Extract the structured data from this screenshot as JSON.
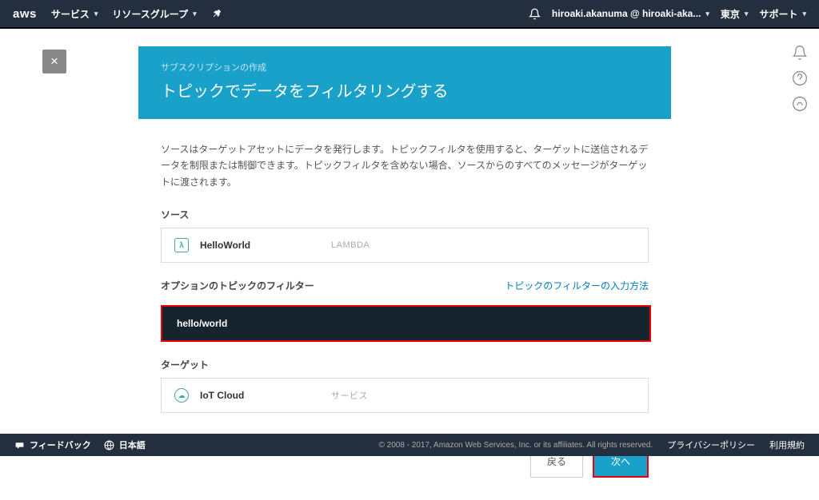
{
  "nav": {
    "logo": "aws",
    "services": "サービス",
    "resource_groups": "リソースグループ",
    "pin": "📌",
    "account": "hiroaki.akanuma @ hiroaki-aka...",
    "region": "東京",
    "support": "サポート"
  },
  "close": "×",
  "card": {
    "subtitle": "サブスクリプションの作成",
    "title": "トピックでデータをフィルタリングする",
    "description": "ソースはターゲットアセットにデータを発行します。トピックフィルタを使用すると、ターゲットに送信されるデータを制限または制御できます。トピックフィルタを含めない場合、ソースからのすべてのメッセージがターゲットに渡されます。",
    "source_label": "ソース",
    "source_name": "HelloWorld",
    "source_type": "LAMBDA",
    "filter_label": "オプションのトピックのフィルター",
    "filter_help": "トピックのフィルターの入力方法",
    "filter_value": "hello/world",
    "target_label": "ターゲット",
    "target_name": "IoT Cloud",
    "target_type": "サービス",
    "back_btn": "戻る",
    "next_btn": "次へ"
  },
  "footer": {
    "feedback": "フィードバック",
    "language": "日本語",
    "copyright": "© 2008 - 2017, Amazon Web Services, Inc. or its affiliates. All rights reserved.",
    "privacy": "プライバシーポリシー",
    "terms": "利用規約"
  }
}
